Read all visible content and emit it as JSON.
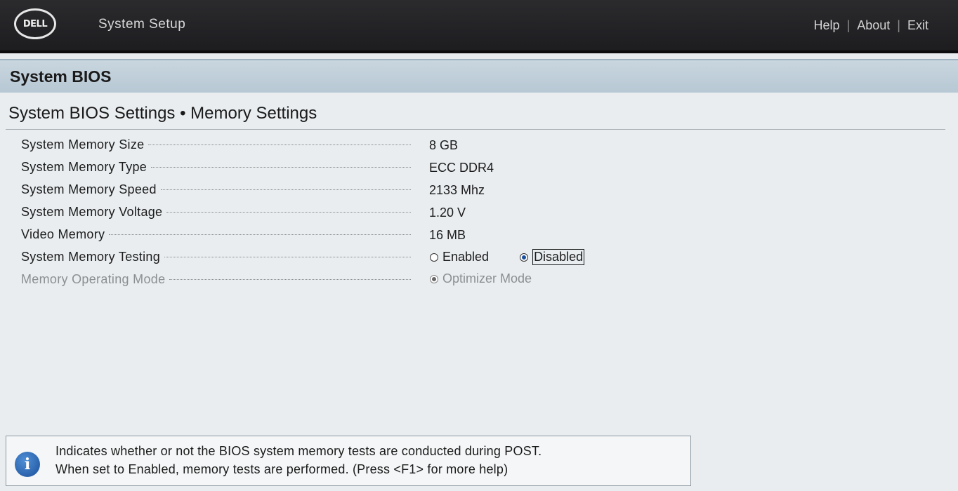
{
  "header": {
    "logo_text": "DELL",
    "app_title": "System Setup",
    "links": [
      "Help",
      "About",
      "Exit"
    ]
  },
  "section": {
    "title": "System BIOS"
  },
  "page": {
    "title": "System BIOS Settings • Memory Settings"
  },
  "settings": [
    {
      "label": "System Memory Size",
      "value": "8 GB"
    },
    {
      "label": "System Memory Type",
      "value": "ECC DDR4"
    },
    {
      "label": "System Memory Speed",
      "value": "2133 Mhz"
    },
    {
      "label": "System Memory Voltage",
      "value": "1.20 V"
    },
    {
      "label": "Video Memory",
      "value": "16 MB"
    },
    {
      "label": "System Memory Testing",
      "options": [
        "Enabled",
        "Disabled"
      ],
      "selected": "Disabled"
    },
    {
      "label": "Memory Operating Mode",
      "options": [
        "Optimizer Mode"
      ],
      "selected": "Optimizer Mode",
      "disabled": true
    }
  ],
  "help": {
    "line1": "Indicates whether or not the BIOS system memory tests are conducted during POST.",
    "line2": "When set to Enabled, memory tests are performed. (Press <F1> for more help)"
  },
  "colors": {
    "header_bg": "#232326",
    "section_bg": "#c2d1db",
    "selected_radio": "#1a4fa0"
  },
  "icons": [
    "dell-logo",
    "info-icon"
  ]
}
